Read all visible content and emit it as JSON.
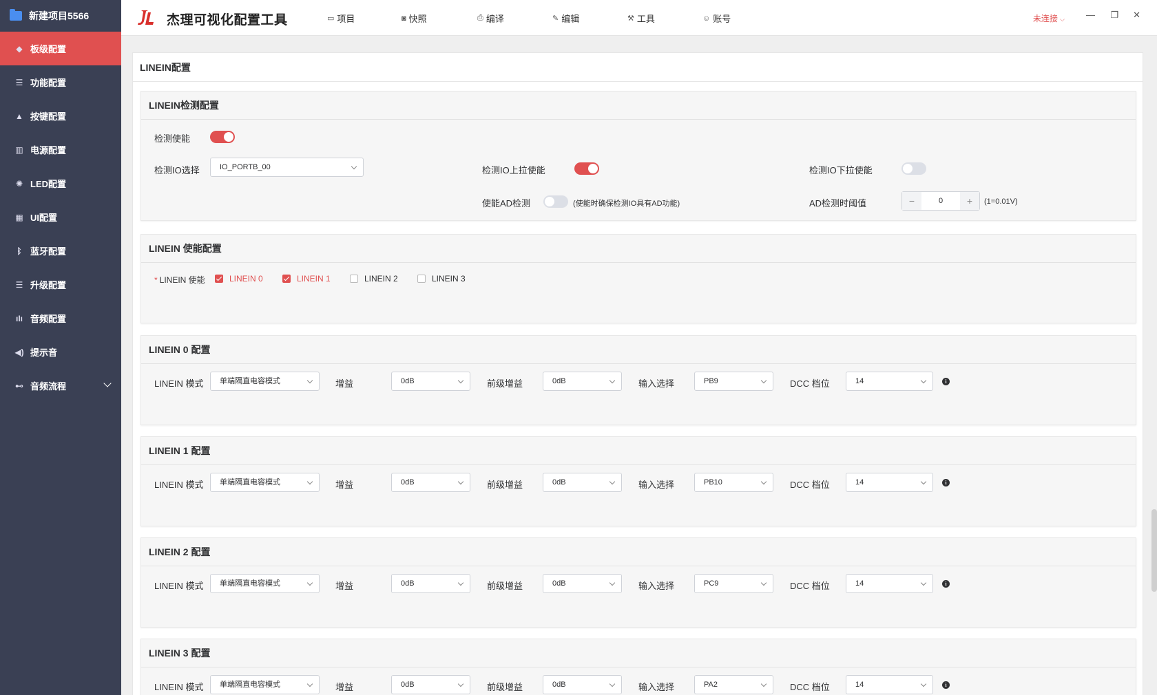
{
  "sidebar": {
    "project": "新建项目5566",
    "items": [
      {
        "label": "板级配置",
        "icon": "cube-icon",
        "active": true
      },
      {
        "label": "功能配置",
        "icon": "list-icon"
      },
      {
        "label": "按键配置",
        "icon": "keys-icon"
      },
      {
        "label": "电源配置",
        "icon": "power-icon"
      },
      {
        "label": "LED配置",
        "icon": "bulb-icon"
      },
      {
        "label": "UI配置",
        "icon": "layout-icon"
      },
      {
        "label": "蓝牙配置",
        "icon": "bluetooth-icon"
      },
      {
        "label": "升级配置",
        "icon": "list-icon"
      },
      {
        "label": "音频配置",
        "icon": "waveform-icon"
      },
      {
        "label": "提示音",
        "icon": "speaker-icon"
      },
      {
        "label": "音频流程",
        "icon": "flow-icon"
      }
    ]
  },
  "header": {
    "title": "杰理可视化配置工具",
    "nav": [
      "项目",
      "快照",
      "编译",
      "编辑",
      "工具",
      "账号"
    ],
    "connection": "未连接",
    "accent": "#e05050"
  },
  "page": {
    "title": "LINEIN配置",
    "detect": {
      "title": "LINEIN检测配置",
      "enable_label": "检测使能",
      "io_label": "检测IO选择",
      "io_value": "IO_PORTB_00",
      "pullup_label": "检测IO上拉使能",
      "pulldown_label": "检测IO下拉使能",
      "ad_label": "使能AD检测",
      "ad_hint": "(使能时确保检测IO具有AD功能)",
      "threshold_label": "AD检测时阈值",
      "threshold_value": "0",
      "threshold_unit": "(1=0.01V)",
      "minus": "−",
      "plus": "+"
    },
    "enable": {
      "title": "LINEIN 使能配置",
      "star": "*",
      "label": "LINEIN 使能",
      "options": [
        {
          "label": "LINEIN 0",
          "checked": true
        },
        {
          "label": "LINEIN 1",
          "checked": true
        },
        {
          "label": "LINEIN 2",
          "checked": false
        },
        {
          "label": "LINEIN 3",
          "checked": false
        }
      ]
    },
    "field_labels": {
      "mode": "LINEIN 模式",
      "gain": "增益",
      "pre_gain": "前级增益",
      "input": "输入选择",
      "dcc": "DCC 档位"
    },
    "channels": [
      {
        "title": "LINEIN 0 配置",
        "mode": "单端隔直电容模式",
        "gain": "0dB",
        "pre_gain": "0dB",
        "input": "PB9",
        "dcc": "14"
      },
      {
        "title": "LINEIN 1 配置",
        "mode": "单端隔直电容模式",
        "gain": "0dB",
        "pre_gain": "0dB",
        "input": "PB10",
        "dcc": "14"
      },
      {
        "title": "LINEIN 2 配置",
        "mode": "单端隔直电容模式",
        "gain": "0dB",
        "pre_gain": "0dB",
        "input": "PC9",
        "dcc": "14"
      },
      {
        "title": "LINEIN 3 配置",
        "mode": "单端隔直电容模式",
        "gain": "0dB",
        "pre_gain": "0dB",
        "input": "PA2",
        "dcc": "14"
      }
    ]
  }
}
